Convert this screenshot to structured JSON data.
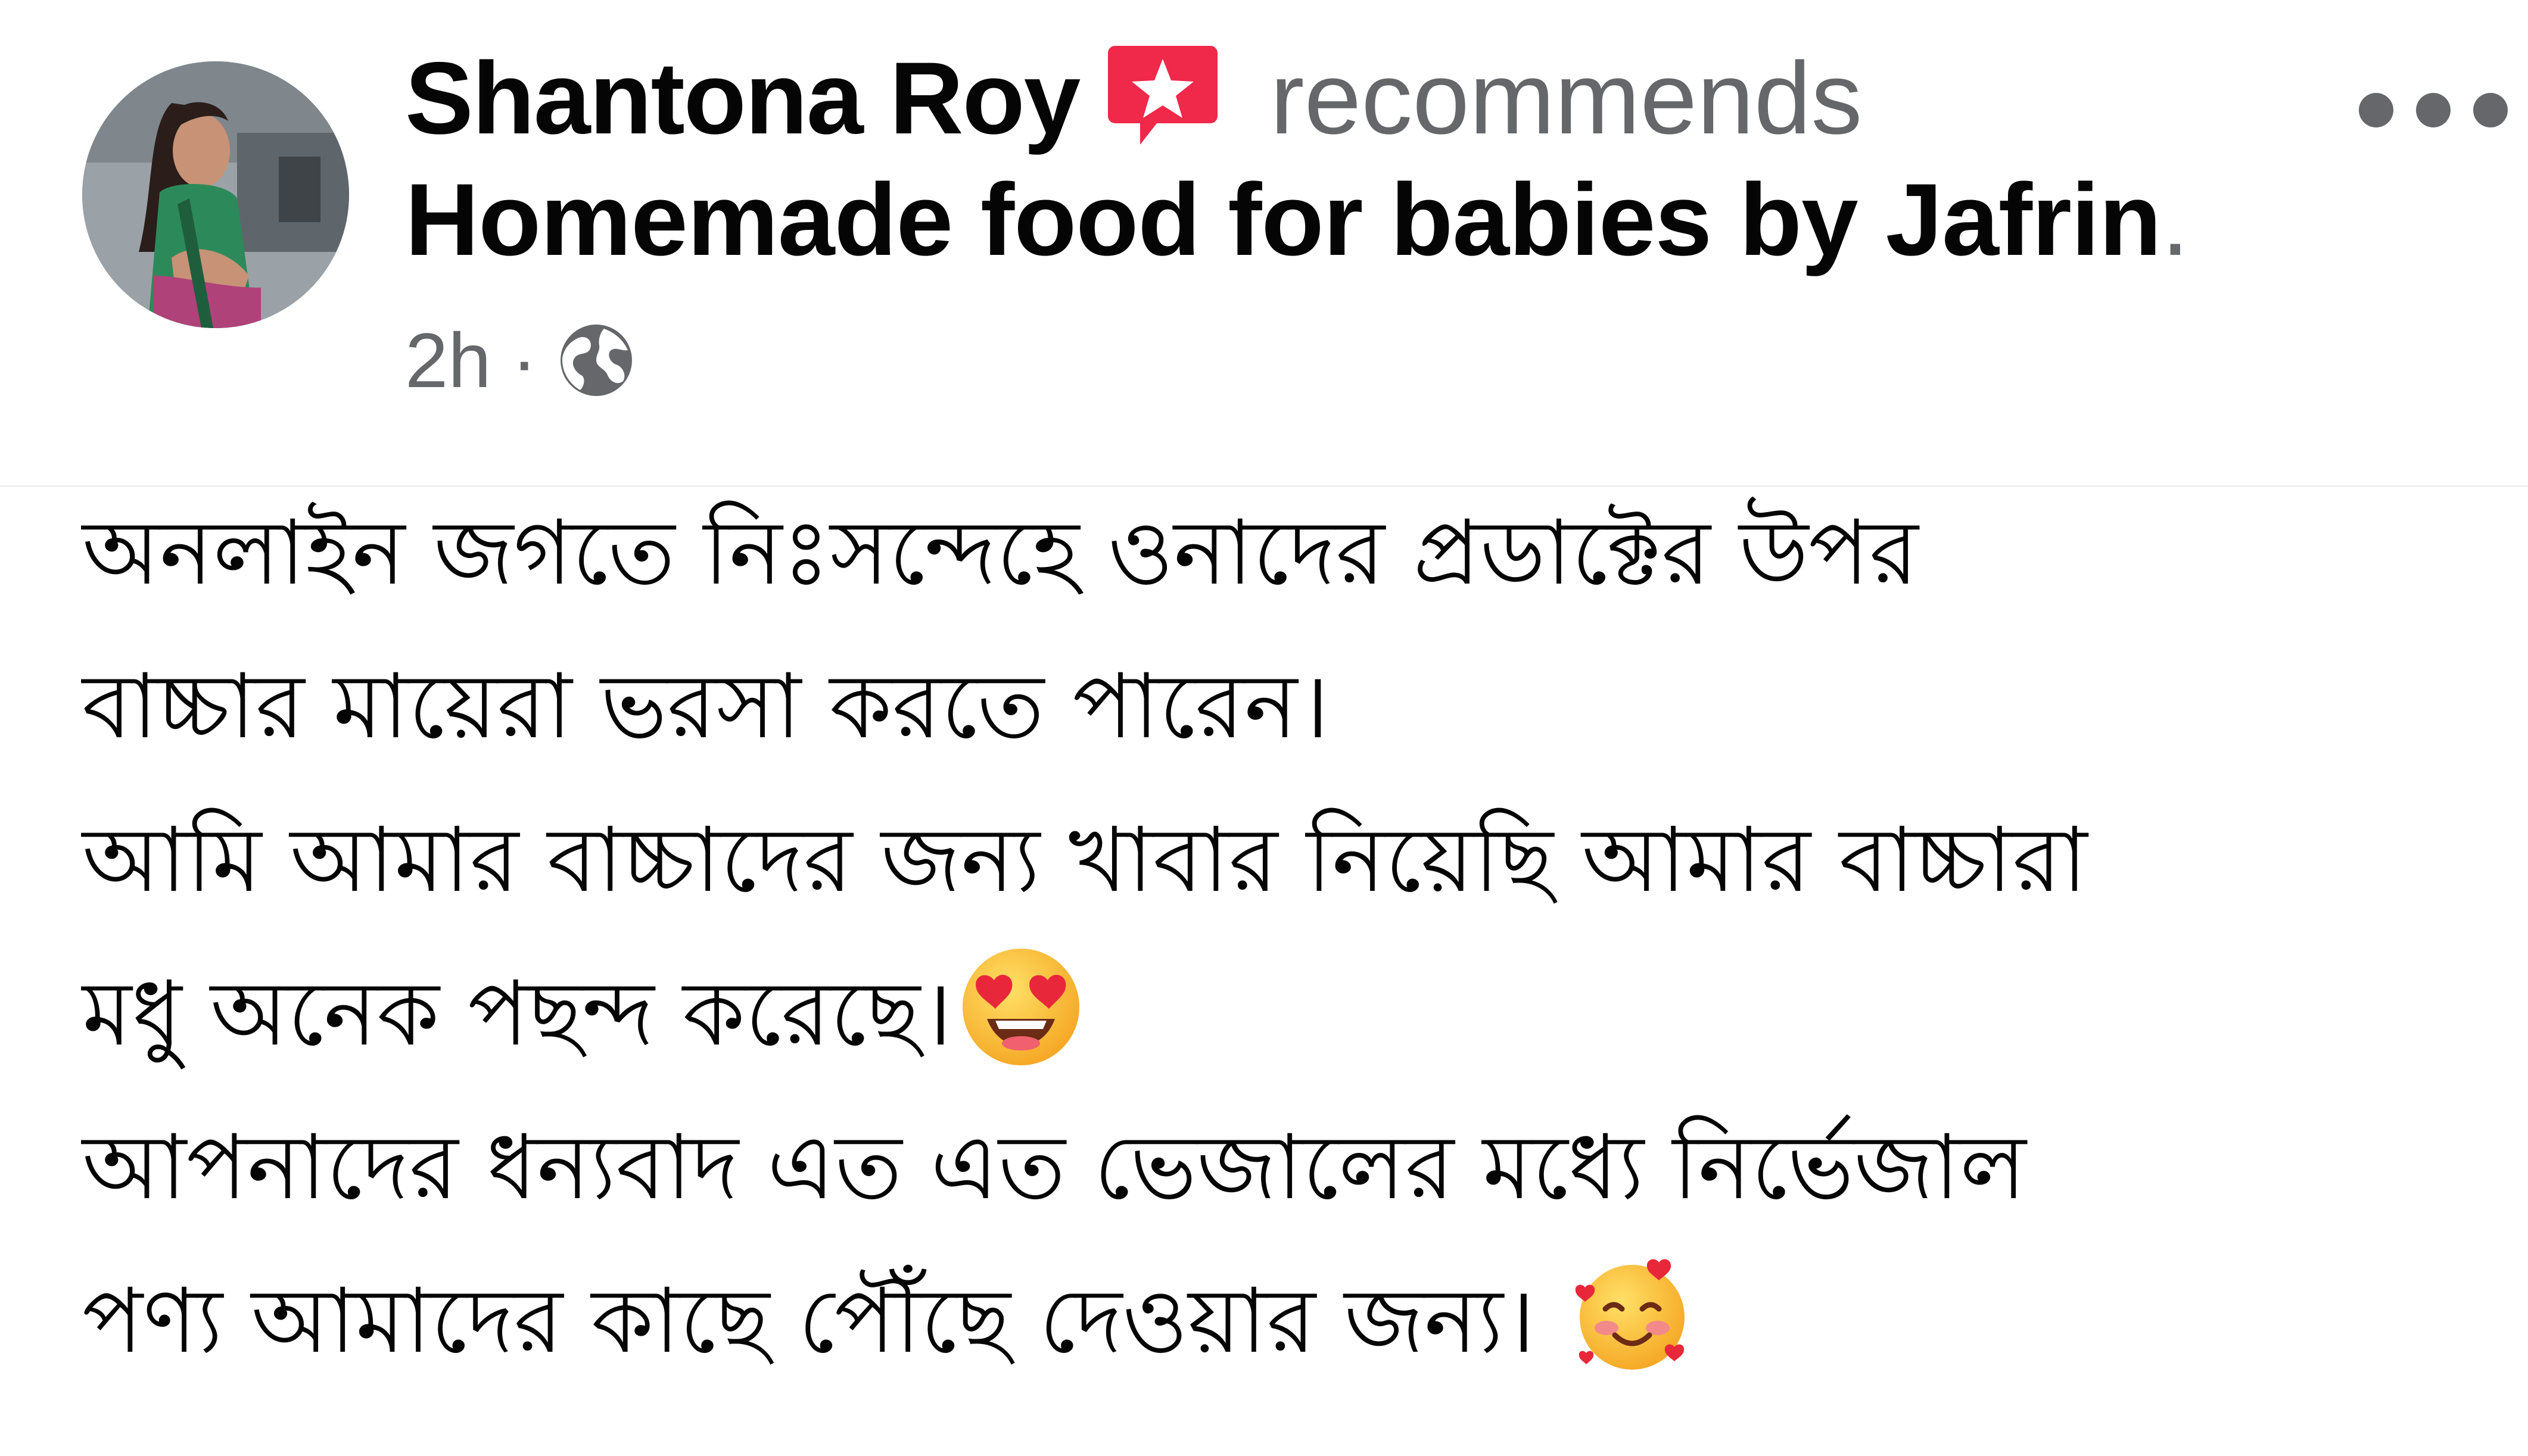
{
  "post": {
    "author_name": "Shantona Roy",
    "action_text": "recommends",
    "page_name": "Homemade food for babies by Jafrin",
    "page_name_suffix": ".",
    "timestamp": "2h",
    "separator": "·",
    "privacy_icon": "globe-icon",
    "recommend_icon": "recommend-star-icon",
    "more_icon": "more-options-icon",
    "body_lines": [
      "অনলাইন জগতে নিঃসন্দেহে ওনাদের প্রডাক্টের উপর",
      "বাচ্চার মায়েরা ভরসা করতে পারেন।",
      "আমি আমার বাচ্চাদের জন্য খাবার নিয়েছি আমার বাচ্চারা",
      "মধু অনেক পছন্দ করেছে।",
      "আপনাদের ধন্যবাদ এত এত ভেজালের মধ্যে নির্ভেজাল",
      "পণ্য আমাদের কাছে পৌঁছে দেওয়ার জন্য।"
    ],
    "emojis": {
      "line_4": "heart-eyes-emoji",
      "line_6": "smiling-face-with-hearts-emoji"
    }
  },
  "colors": {
    "primary_text": "#050505",
    "secondary_text": "#65676b",
    "recommend_badge": "#f02849",
    "background": "#ffffff"
  }
}
